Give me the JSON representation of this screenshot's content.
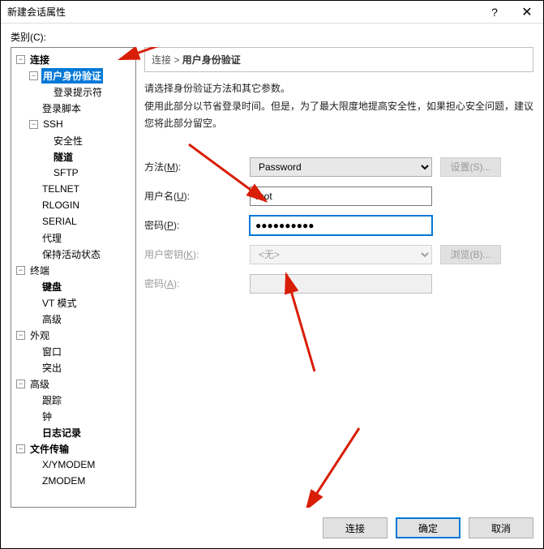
{
  "window": {
    "title": "新建会话属性",
    "help": "?",
    "close": "✕"
  },
  "category_label": "类别(C):",
  "tree": {
    "connection": "连接",
    "user_auth": "用户身份验证",
    "login_prompt": "登录提示符",
    "login_script": "登录脚本",
    "ssh": "SSH",
    "security": "安全性",
    "tunnel": "隧道",
    "sftp": "SFTP",
    "telnet": "TELNET",
    "rlogin": "RLOGIN",
    "serial": "SERIAL",
    "proxy": "代理",
    "keepalive": "保持活动状态",
    "terminal": "终端",
    "keyboard": "键盘",
    "vt_mode": "VT 模式",
    "advanced_term": "高级",
    "appearance": "外观",
    "window": "窗口",
    "highlight": "突出",
    "advanced": "高级",
    "trace": "跟踪",
    "bell": "钟",
    "logging": "日志记录",
    "file_transfer": "文件传输",
    "xymodem": "X/YMODEM",
    "zmodem": "ZMODEM"
  },
  "breadcrumb": {
    "parent": "连接",
    "sep": " > ",
    "current": "用户身份验证"
  },
  "desc": {
    "line1": "请选择身份验证方法和其它参数。",
    "line2": "使用此部分以节省登录时间。但是，为了最大限度地提高安全性，如果担心安全问题，建议您将此部分留空。"
  },
  "form": {
    "method_label": "方法(M):",
    "method_value": "Password",
    "settings_btn": "设置(S)...",
    "username_label": "用户名(U):",
    "username_value": "root",
    "password_label": "密码(P):",
    "password_value": "●●●●●●●●●●",
    "userkey_label": "用户密钥(K):",
    "userkey_value": "<无>",
    "browse_btn": "浏览(B)...",
    "password2_label": "密码(A):"
  },
  "buttons": {
    "connect": "连接",
    "ok": "确定",
    "cancel": "取消"
  }
}
